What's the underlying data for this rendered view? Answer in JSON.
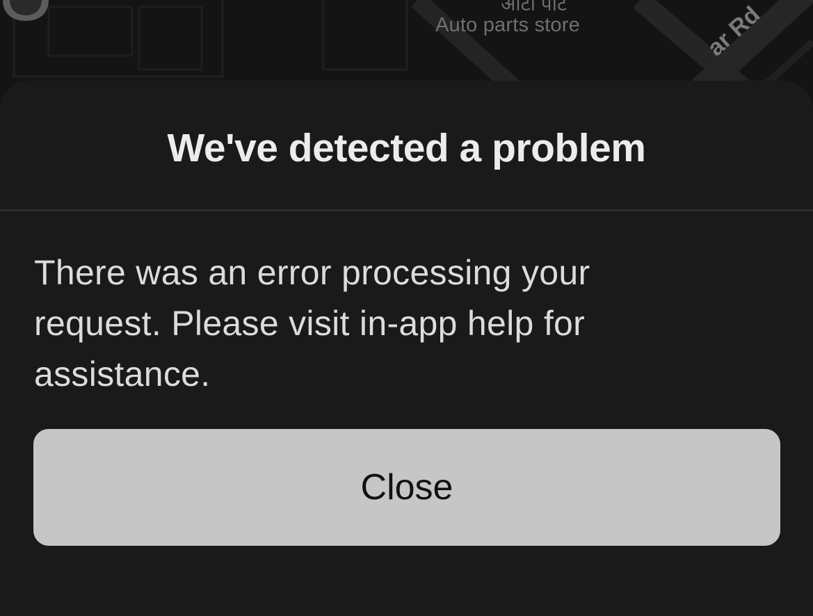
{
  "map": {
    "poi_top_label": "ऑटो पार्ट",
    "poi_label": "Auto parts store",
    "road_label": "ar Rd",
    "marker_icon": "map-pin-icon"
  },
  "dialog": {
    "title": "We've detected a problem",
    "message": "There was an error processing your request. Please visit in-app help for assistance.",
    "close_label": "Close"
  },
  "colors": {
    "sheet_background": "#1a1a1a",
    "button_background": "#c6c6c6",
    "title_text": "#ececec"
  }
}
